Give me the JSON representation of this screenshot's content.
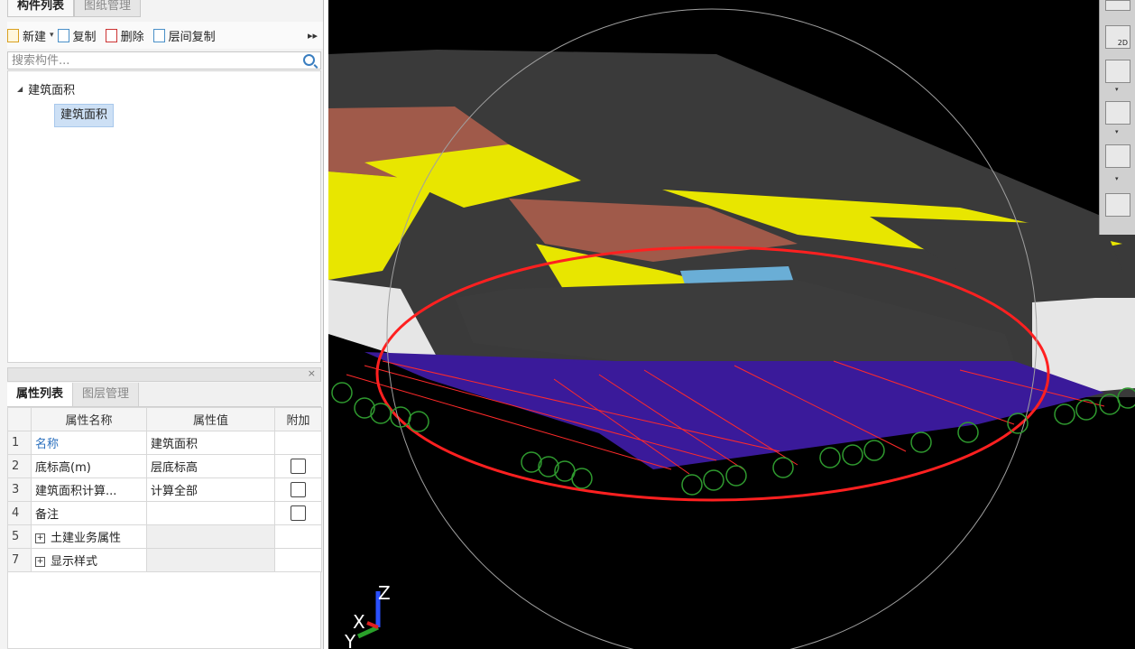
{
  "left_panel": {
    "top_tabs": [
      "构件列表",
      "图纸管理"
    ],
    "toolbar": {
      "new_label": "新建",
      "copy_label": "复制",
      "delete_label": "删除",
      "layer_copy_label": "层间复制",
      "more_glyph": "▸▸"
    },
    "search": {
      "placeholder": "搜索构件..."
    },
    "tree": {
      "parent_label": "建筑面积",
      "child_label": "建筑面积"
    },
    "panel2_close_glyph": "×",
    "props_tabs": [
      "属性列表",
      "图层管理"
    ],
    "props_table": {
      "headers": [
        "属性名称",
        "属性值",
        "附加"
      ],
      "rows": [
        {
          "num": "1",
          "name": "名称",
          "value": "建筑面积"
        },
        {
          "num": "2",
          "name": "底标高(m)",
          "value": "层底标高"
        },
        {
          "num": "3",
          "name": "建筑面积计算...",
          "value": "计算全部"
        },
        {
          "num": "4",
          "name": "备注",
          "value": ""
        },
        {
          "num": "5",
          "name": "土建业务属性",
          "value": ""
        },
        {
          "num": "7",
          "name": "显示样式",
          "value": ""
        }
      ]
    }
  },
  "viewport": {
    "axis_labels": {
      "x": "X",
      "y": "Y",
      "z": "Z"
    }
  },
  "right_toolbar": {
    "view2d_label": "2D"
  }
}
